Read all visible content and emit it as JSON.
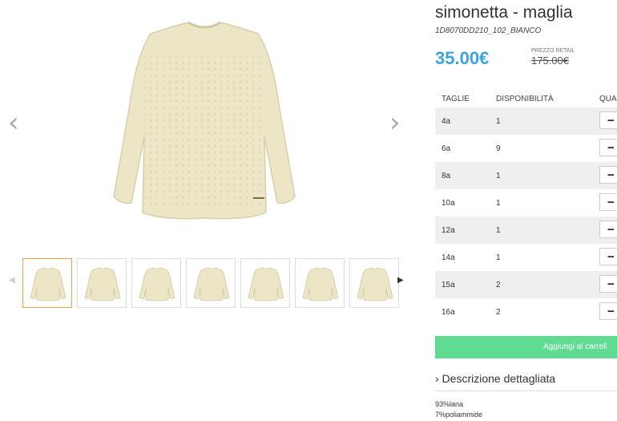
{
  "product": {
    "title": "simonetta - maglia",
    "sku": "1D8070DD210_102_BIANCO",
    "price": "35.00€",
    "retail_label": "PREZZO RETAIL",
    "retail_price": "175.00€"
  },
  "gallery": {
    "prev_icon": "chevron-left-icon",
    "next_icon": "chevron-right-icon",
    "thumbnail_count": 7,
    "active_thumbnail": 1
  },
  "table": {
    "headers": [
      "TAGLIE",
      "DISPONIBILITÀ",
      "QUA"
    ],
    "rows": [
      {
        "size": "4a",
        "available": "1"
      },
      {
        "size": "6a",
        "available": "9"
      },
      {
        "size": "8a",
        "available": "1"
      },
      {
        "size": "10a",
        "available": "1"
      },
      {
        "size": "12a",
        "available": "1"
      },
      {
        "size": "14a",
        "available": "1"
      },
      {
        "size": "15a",
        "available": "2"
      },
      {
        "size": "16a",
        "available": "2"
      }
    ],
    "qty_button_symbol": "−"
  },
  "cart": {
    "label": "Aggiungi al carrell"
  },
  "description": {
    "toggle": "› Descrizione dettagliata",
    "lines": [
      "93%lana",
      "7%poliammide"
    ]
  },
  "colors": {
    "price": "#3ba4dc",
    "cart": "#5fdc92",
    "active_thumb": "#f0a24a"
  }
}
